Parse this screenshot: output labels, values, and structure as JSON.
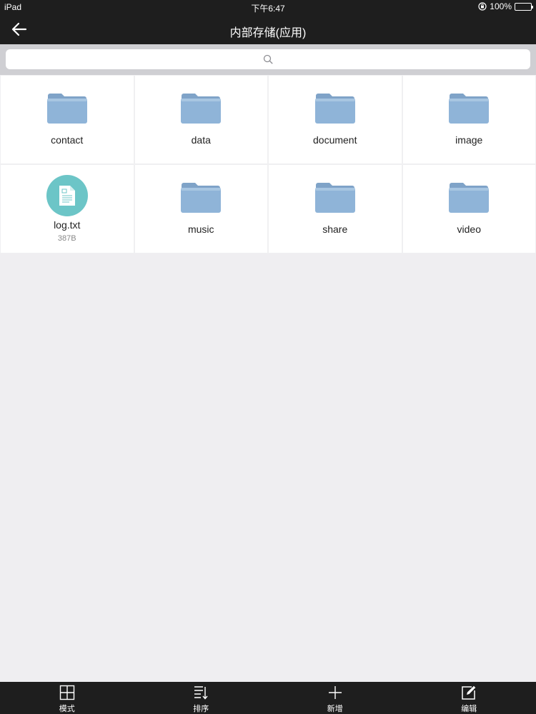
{
  "status": {
    "device": "iPad",
    "time": "下午6:47",
    "battery": "100%"
  },
  "nav": {
    "title": "内部存储(应用)"
  },
  "search": {
    "placeholder": ""
  },
  "items": [
    {
      "name": "contact",
      "type": "folder"
    },
    {
      "name": "data",
      "type": "folder"
    },
    {
      "name": "document",
      "type": "folder"
    },
    {
      "name": "image",
      "type": "folder"
    },
    {
      "name": "log.txt",
      "type": "file",
      "size": "387B"
    },
    {
      "name": "music",
      "type": "folder"
    },
    {
      "name": "share",
      "type": "folder"
    },
    {
      "name": "video",
      "type": "folder"
    }
  ],
  "toolbar": {
    "mode_label": "模式",
    "sort_label": "排序",
    "add_label": "新增",
    "edit_label": "编辑"
  },
  "colors": {
    "bar": "#1e1e1e",
    "folder": "#8fb2d6",
    "file_badge": "#6cc5c7",
    "background": "#efeef1"
  }
}
